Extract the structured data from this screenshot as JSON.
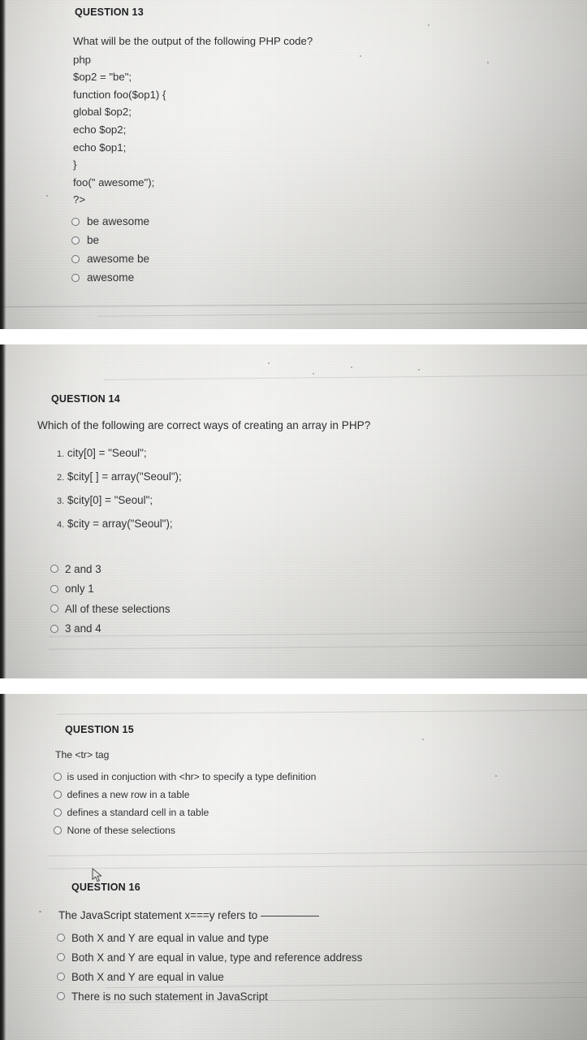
{
  "meta": {
    "accent_text_color": "#2f3234",
    "panel_background": "#dfdeda",
    "separator_color": "#ffffff"
  },
  "question13": {
    "header": "QUESTION 13",
    "stem": "What will be the output of the following PHP code?",
    "code": [
      "php",
      "$op2 = \"be\";",
      "function foo($op1) {",
      "global $op2;",
      "echo $op2;",
      "echo $op1;",
      "}",
      "foo(\" awesome\");",
      "?>"
    ],
    "options": [
      "be awesome",
      "be",
      "awesome be",
      "awesome"
    ]
  },
  "question14": {
    "header": "QUESTION 14",
    "stem": "Which of the following are correct ways of creating an array in PHP?",
    "items": [
      {
        "index": "1.",
        "text": "city[0] = \"Seoul\";"
      },
      {
        "index": "2.",
        "text": "$city[ ] = array(\"Seoul\");"
      },
      {
        "index": "3.",
        "text": "$city[0] = \"Seoul\";"
      },
      {
        "index": "4.",
        "text": "$city = array(\"Seoul\");"
      }
    ],
    "options": [
      "2 and 3",
      "only 1",
      "All of these selections",
      "3 and 4"
    ]
  },
  "question15": {
    "header": "QUESTION 15",
    "stem": "The <tr> tag",
    "options": [
      "is used in conjuction with <hr> to specify a type definition",
      "defines a new row in a table",
      "defines a standard cell in a table",
      "None of these selections"
    ]
  },
  "question16": {
    "header": "QUESTION 16",
    "stem_prefix": "The JavaScript statement x===y refers to",
    "options": [
      "Both X and Y are equal in value and type",
      "Both X and Y are equal in value, type and reference address",
      "Both X and Y are equal in value",
      "There is no such statement in JavaScript"
    ]
  }
}
